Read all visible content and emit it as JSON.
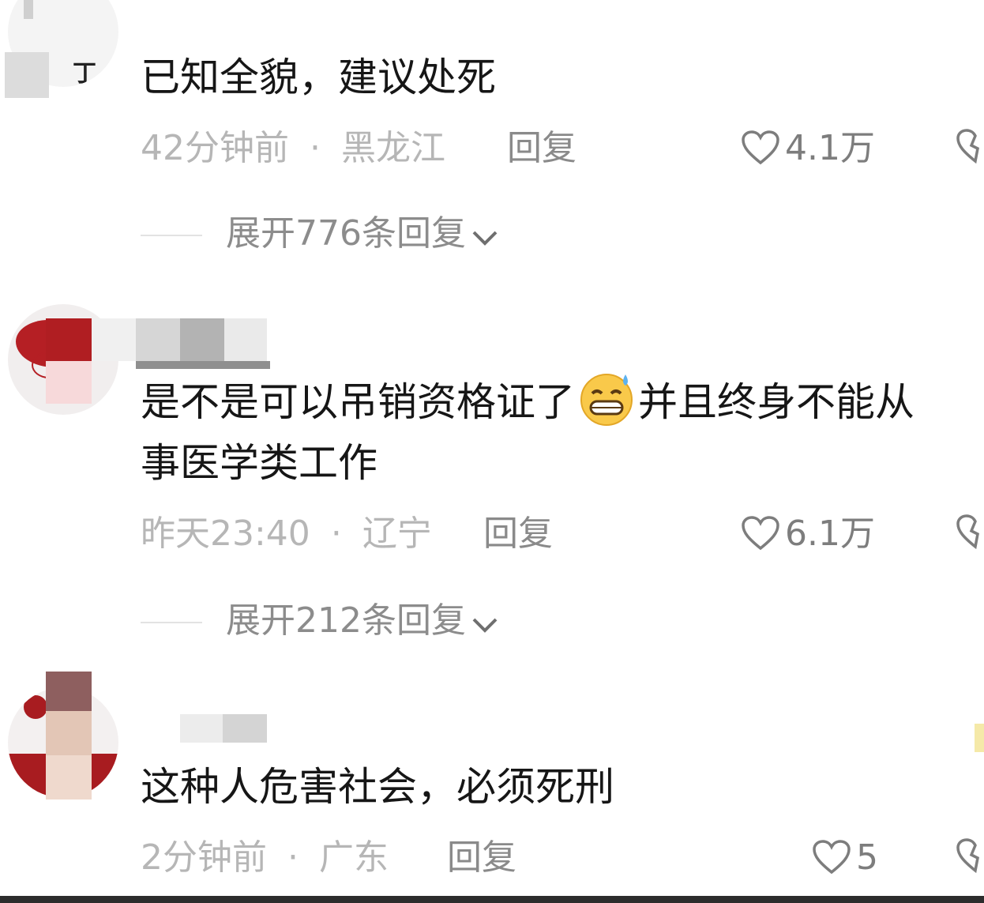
{
  "comments": [
    {
      "text": "已知全貌，建议处死",
      "time": "42分钟前",
      "location": "黑龙江",
      "reply_label": "回复",
      "likes": "4.1万",
      "expand_label": "展开776条回复"
    },
    {
      "text_line1": "是不是可以吊销资格证了",
      "emoji": "grinning-sweat-emoji",
      "text_line1b": "并且终身不能从",
      "text_line2": "事医学类工作",
      "time": "昨天23:40",
      "location": "辽宁",
      "reply_label": "回复",
      "likes": "6.1万",
      "expand_label": "展开212条回复"
    },
    {
      "text": "这种人危害社会，必须死刑",
      "time": "2分钟前",
      "location": "广东",
      "reply_label": "回复",
      "likes": "5"
    }
  ],
  "separator": "·",
  "colors": {
    "text": "#161616",
    "meta": "#b6b6b6",
    "reply": "#8a8a8a",
    "avatar_red": "#b01e22"
  }
}
